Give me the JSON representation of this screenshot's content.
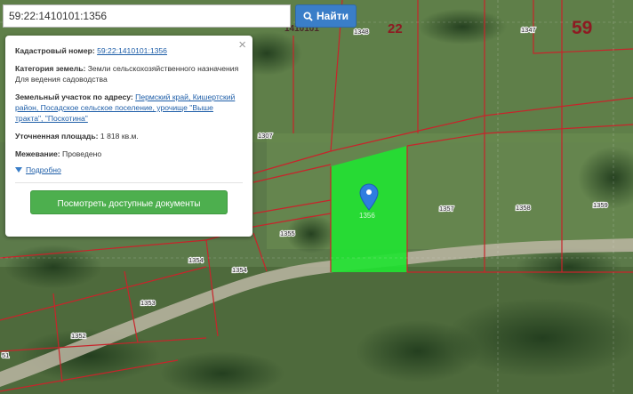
{
  "search": {
    "value": "59:22:1410101:1356",
    "button_label": "Найти"
  },
  "map": {
    "block_numbers": [
      "22",
      "59"
    ],
    "block_partial_label": "1410101",
    "parcel_numbers": [
      "1348",
      "1347",
      "1307",
      "1357",
      "1358",
      "1359",
      "1355",
      "1354",
      "1354",
      "1353",
      "1352",
      "51"
    ],
    "selected_parcel_label": "1356",
    "colors": {
      "boundary": "#c8242b",
      "selected_fill": "#22e232",
      "marker": "#2f7de0"
    }
  },
  "popup": {
    "close_glyph": "×",
    "cadastral_label": "Кадастровый номер:",
    "cadastral_value": "59:22:1410101:1356",
    "category_label": "Категория земель:",
    "category_value": "Земли сельскохозяйственного назначения",
    "use_value": "Для ведения садоводства",
    "address_label": "Земельный участок по адресу:",
    "address_value": "Пермский край, Кишертский район, Посадское сельское поселение, урочище \"Выше тракта\", \"Поскотина\"",
    "area_label": "Уточненная площадь:",
    "area_value": "1 818 кв.м.",
    "survey_label": "Межевание:",
    "survey_value": "Проведено",
    "details_link": "Подробно",
    "docs_button": "Посмотреть доступные документы"
  }
}
